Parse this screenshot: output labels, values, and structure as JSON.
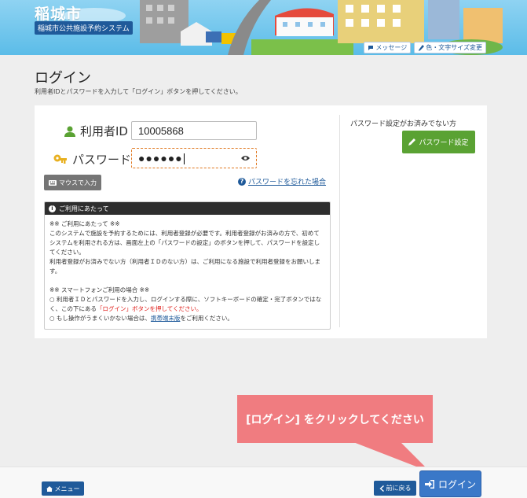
{
  "header": {
    "city_name": "稲城市",
    "system_name": "稲城市公共施設予約システム",
    "links": [
      {
        "label": "メッセージ",
        "icon": "speech-bubble-icon"
      },
      {
        "label": "色・文字サイズ変更",
        "icon": "brush-icon"
      }
    ]
  },
  "page": {
    "title": "ログイン",
    "description": "利用者IDとパスワードを入力して「ログイン」ボタンを押してください。"
  },
  "login_form": {
    "user_id_label": "利用者ID",
    "user_id_value": "10005868",
    "password_label": "パスワード",
    "password_masked": "●●●●●●",
    "mouse_input_label": "マウスで入力",
    "forgot_password_label": "パスワードを忘れた場合"
  },
  "notice": {
    "heading": "ご利用にあたって",
    "section1_title": "※※ ご利用にあたって ※※",
    "section1_text1": "このシステムで施設を予約するためには、利用者登録が必要です。利用者登録がお済みの方で、初めてシステムを利用される方は、画面左上の「パスワードの設定」のボタンを押して、パスワードを設定してください。",
    "section1_text2": "利用者登録がお済みでない方（利用者ＩＤのない方）は、ご利用になる施設で利用者登録をお願いします。",
    "section2_title": "※※ スマートフォンご利用の場合 ※※",
    "section2_line1": "○ 利用者ＩＤとパスワードを入力し、ログインする際に、ソフトキーボードの確定・完了ボタンではなく、この下にある",
    "section2_red": "「ログイン」ボタンを押してください。",
    "section2_line2_pre": "○ もし操作がうまくいかない場合は、",
    "section2_link": "携帯端末版",
    "section2_line2_post": "をご利用ください。"
  },
  "right_panel": {
    "caption": "パスワード設定がお済みでない方",
    "button_label": "パスワード設定"
  },
  "footer": {
    "menu_label": "メニュー",
    "back_label": "前に戻る",
    "login_label": "ログイン"
  },
  "callout": {
    "text": "[ログイン] をクリックしてください"
  },
  "colors": {
    "primary_blue": "#1f5a9a",
    "login_blue": "#3a78c8",
    "green": "#5aa233",
    "callout_pink": "#f07c80",
    "notice_red": "#e0201c"
  }
}
